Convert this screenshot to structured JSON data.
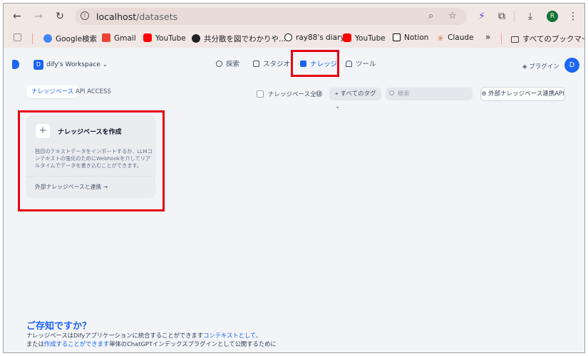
{
  "browser": {
    "url_host": "localhost",
    "url_path": "/datasets",
    "profile_initial": "R",
    "bookmarks": [
      {
        "label": "Google検索",
        "icon": "google-icon",
        "color": "#4285f4"
      },
      {
        "label": "Gmail",
        "icon": "gmail-icon",
        "color": "#ea4335"
      },
      {
        "label": "YouTube",
        "icon": "youtube-icon",
        "color": "#ff0000"
      },
      {
        "label": "共分散を図でわかりや...",
        "icon": "question-icon",
        "color": "#202124"
      },
      {
        "label": "ray88's diary",
        "icon": "hatena-icon",
        "color": "#202124"
      },
      {
        "label": "YouTube",
        "icon": "youtube-icon",
        "color": "#ff0000"
      },
      {
        "label": "Notion",
        "icon": "notion-icon",
        "color": "#000000"
      },
      {
        "label": "Claude",
        "icon": "claude-icon",
        "color": "#d97757"
      }
    ],
    "more": "»",
    "all_bookmarks": "すべてのブックマーク"
  },
  "header": {
    "workspace_initial": "D",
    "workspace_name": "dify's Workspace",
    "nav": [
      {
        "label": "探索",
        "icon": "explore-icon"
      },
      {
        "label": "スタジオ",
        "icon": "studio-icon"
      },
      {
        "label": "ナレッジ",
        "icon": "knowledge-icon",
        "active": true
      },
      {
        "label": "ツール",
        "icon": "tools-icon"
      }
    ],
    "plugin": "プラグイン",
    "user_initial": "D"
  },
  "tabs": [
    {
      "label": "ナレッジベース",
      "active": true
    },
    {
      "label": "API ACCESS"
    }
  ],
  "filters": {
    "all_knowledge": "ナレッジベース全体",
    "tags": "すべてのタグ",
    "search_placeholder": "検索",
    "external_api": "外部ナレッジベース連携API"
  },
  "create_card": {
    "title": "ナレッジベースを作成",
    "desc": "独自のテキストデータをインポートするか、LLMコンテキストの強化のためにWebhookを介してリアルタイムでデータを書き込むことができます。",
    "link": "外部ナレッジベースと連携 →"
  },
  "tips": {
    "title": "ご存知ですか？",
    "line1_a": "ナレッジベースはDifyアプリケーションに統合することができます",
    "line1_link": "コンテキストとして",
    "line1_b": "、",
    "line2_a": "または",
    "line2_link": "作成することができます",
    "line2_b": "単体のChatGPTインデックスプラグインとして公開するために"
  },
  "colors": {
    "accent": "#1c64f2",
    "highlight": "#e60012"
  }
}
